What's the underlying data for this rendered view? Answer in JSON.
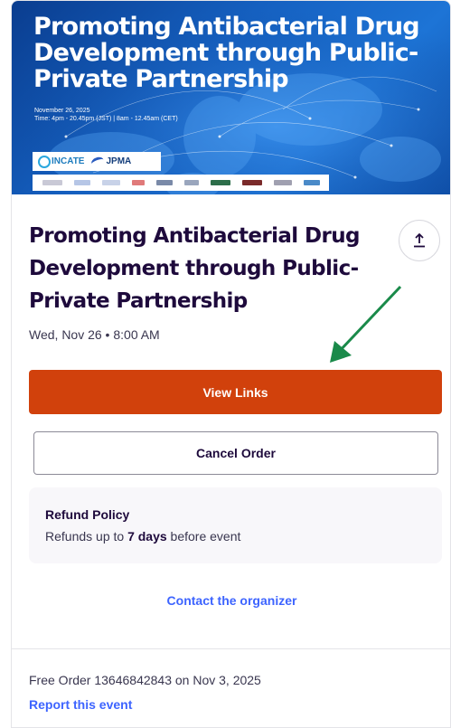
{
  "banner": {
    "title": "Promoting Antibacterial Drug Development through Public-Private Partnership",
    "date": "November 26, 2025",
    "time": "Time: 4pm - 20.45pm (JST) | 8am - 12.45am (CET)",
    "logos": {
      "cincate": "INCATE",
      "jpma": "JPMA"
    }
  },
  "event": {
    "title": "Promoting Antibacterial Drug Development through Public-Private Partnership",
    "date": "Wed, Nov 26 • 8:00 AM"
  },
  "actions": {
    "share_icon": "share-upload-icon",
    "primary_label": "View Links",
    "secondary_label": "Cancel Order"
  },
  "refund": {
    "title": "Refund Policy",
    "prefix": "Refunds up to ",
    "days": "7 days",
    "suffix": " before event"
  },
  "links": {
    "contact": "Contact the organizer",
    "report": "Report this event"
  },
  "order": {
    "info": "Free Order 13646842843 on Nov 3, 2025"
  },
  "colors": {
    "primary": "#d1410c",
    "link": "#3d64ff",
    "text": "#1e0a3c",
    "annotation_arrow": "#1a8a4a"
  }
}
